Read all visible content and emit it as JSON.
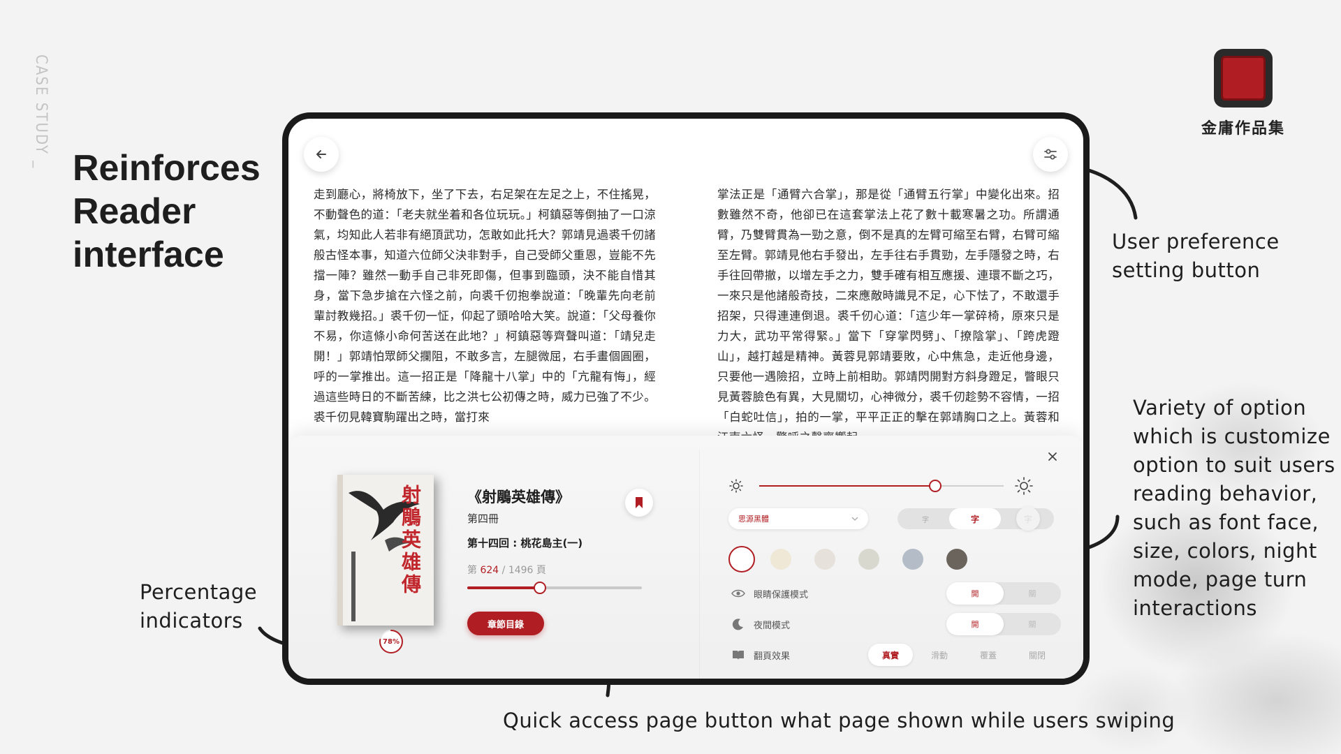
{
  "slide": {
    "case_study_label": "CASE STUDY _",
    "headline": "Reinforces Reader interface",
    "brand_name": "金庸作品集",
    "annotations": {
      "settings": "User preference setting button",
      "options": "Variety of option which is customize option to suit users reading behavior, such as font face, size, colors, night mode, page turn interactions",
      "percentage": "Percentage indicators",
      "quick_access": "Quick access page button what page shown while users swiping"
    }
  },
  "reader": {
    "page_left": "走到廳心，將椅放下，坐了下去，右足架在左足之上，不住搖晃，不動聲色的道：「老夫就坐着和各位玩玩。」柯鎮惡等倒抽了一口涼氣，均知此人若非有絕頂武功，怎敢如此托大？郭靖見過裘千仞諸般古怪本事，知道六位師父決非對手，自己受師父重恩，豈能不先擋一陣？雖然一動手自己非死即傷，但事到臨頭，決不能自惜其身，當下急步搶在六怪之前，向裘千仞抱拳說道：「晚輩先向老前輩討教幾招。」裘千仞一怔，仰起了頭哈哈大笑。說道：「父母養你不易，你這條小命何苦送在此地？」柯鎮惡等齊聲叫道：「靖兒走開！」郭靖怕眾師父攔阻，不敢多言，左腿微屈，右手畫個圓圈，呼的一掌推出。這一招正是「降龍十八掌」中的「亢龍有悔」，經過這些時日的不斷苦練，比之洪七公初傳之時，威力已強了不少。裘千仞見韓寶駒躍出之時，當打來",
    "page_right": "掌法正是「通臂六合掌」，那是從「通臂五行掌」中變化出來。招數雖然不奇，他卻已在這套掌法上花了數十載寒暑之功。所謂通臂，乃雙臂貫為一勁之意，倒不是真的左臂可縮至右臂，右臂可縮至左臂。郭靖見他右手發出，左手往右手貫勁，左手隱發之時，右手往回帶撤，以增左手之力，雙手確有相互應援、連環不斷之巧，一來只是他諸般奇技，二來應敵時識見不足，心下怯了，不敢還手招架，只得連連倒退。裘千仞心道：「這少年一掌碎椅，原來只是力大，武功平常得緊。」當下「穿掌閃劈」、「撩陰掌」、「跨虎蹬山」，越打越是精神。黃蓉見郭靖要敗，心中焦急，走近他身邊，只要他一遇險招，立時上前相助。郭靖閃開對方斜身蹬足，瞥眼只見黃蓉臉色有異，大見關切，心神微分，裘千仞趁勢不容情，一招「白蛇吐信」，拍的一掌，平平正正的擊在郭靖胸口之上。黃蓉和江南六怪，驚呼之聲齊響起。"
  },
  "book_panel": {
    "book_title": "《射鵰英雄傳》",
    "cover_title": "射鵰英雄傳",
    "volume": "第四冊",
    "chapter": "第十四回 : 桃花島主(一)",
    "page_prefix": "第",
    "page_current": "624",
    "page_sep": " / ",
    "page_total": "1496",
    "page_suffix": "頁",
    "percent_label": "78%",
    "percent_value": 0.78,
    "toc_button": "章節目錄",
    "accent": "#b01e23"
  },
  "settings_panel": {
    "brightness": 0.72,
    "font_face": "思源黑體",
    "font_size_small": "字",
    "font_size_large": "字",
    "font_size_third": "字",
    "swatch_colors": [
      "#ffffff",
      "#efe8d6",
      "#e6e1da",
      "#d8d8cf",
      "#b4bcc7",
      "#6a645c"
    ],
    "eye_protection": {
      "label": "眼睛保護模式",
      "on": "開",
      "off": "關"
    },
    "night_mode": {
      "label": "夜間模式",
      "on": "開",
      "off": "關"
    },
    "page_turn": {
      "label": "翻頁效果",
      "options": [
        "真實",
        "滑動",
        "覆蓋",
        "關閉"
      ]
    }
  }
}
